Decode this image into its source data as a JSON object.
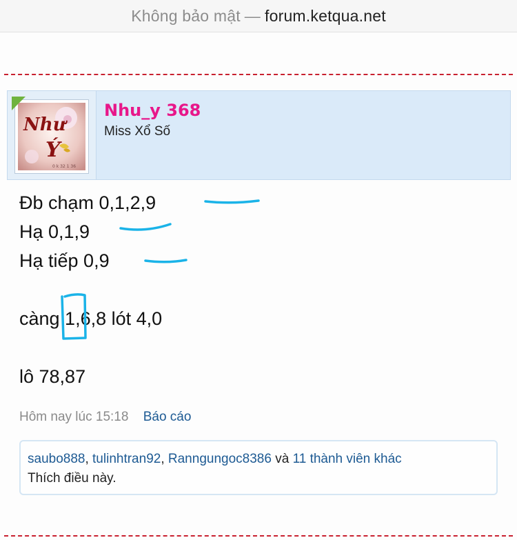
{
  "browser": {
    "security_label": "Không bảo mật",
    "separator": "—",
    "host": "forum.ketqua.net"
  },
  "user": {
    "name": "Nhu_y 368",
    "title": "Miss Xổ Số",
    "avatar_text": "Như Ý",
    "avatar_subtext": "0 k 32 1 36",
    "name_color": "#e8178a"
  },
  "post": {
    "lines": [
      "Đb chạm 0,1,2,9",
      "Hạ 0,1,9",
      "Hạ tiếp 0,9",
      "càng 1,6,8 lót 4,0",
      "lô 78,87"
    ]
  },
  "meta": {
    "time": "Hôm nay lúc 15:18",
    "report_label": "Báo cáo"
  },
  "likes": {
    "users": [
      "saubo888",
      "tulinhtran92",
      "Ranngungoc8386"
    ],
    "comma": ",",
    "and_word": "và",
    "others": "11 thành viên khác",
    "suffix": "Thích điều này."
  },
  "colors": {
    "accent": "#1d5a93",
    "divider": "#c8202f",
    "card_bg": "#daeaf9",
    "annotation": "#1ab3e8"
  }
}
